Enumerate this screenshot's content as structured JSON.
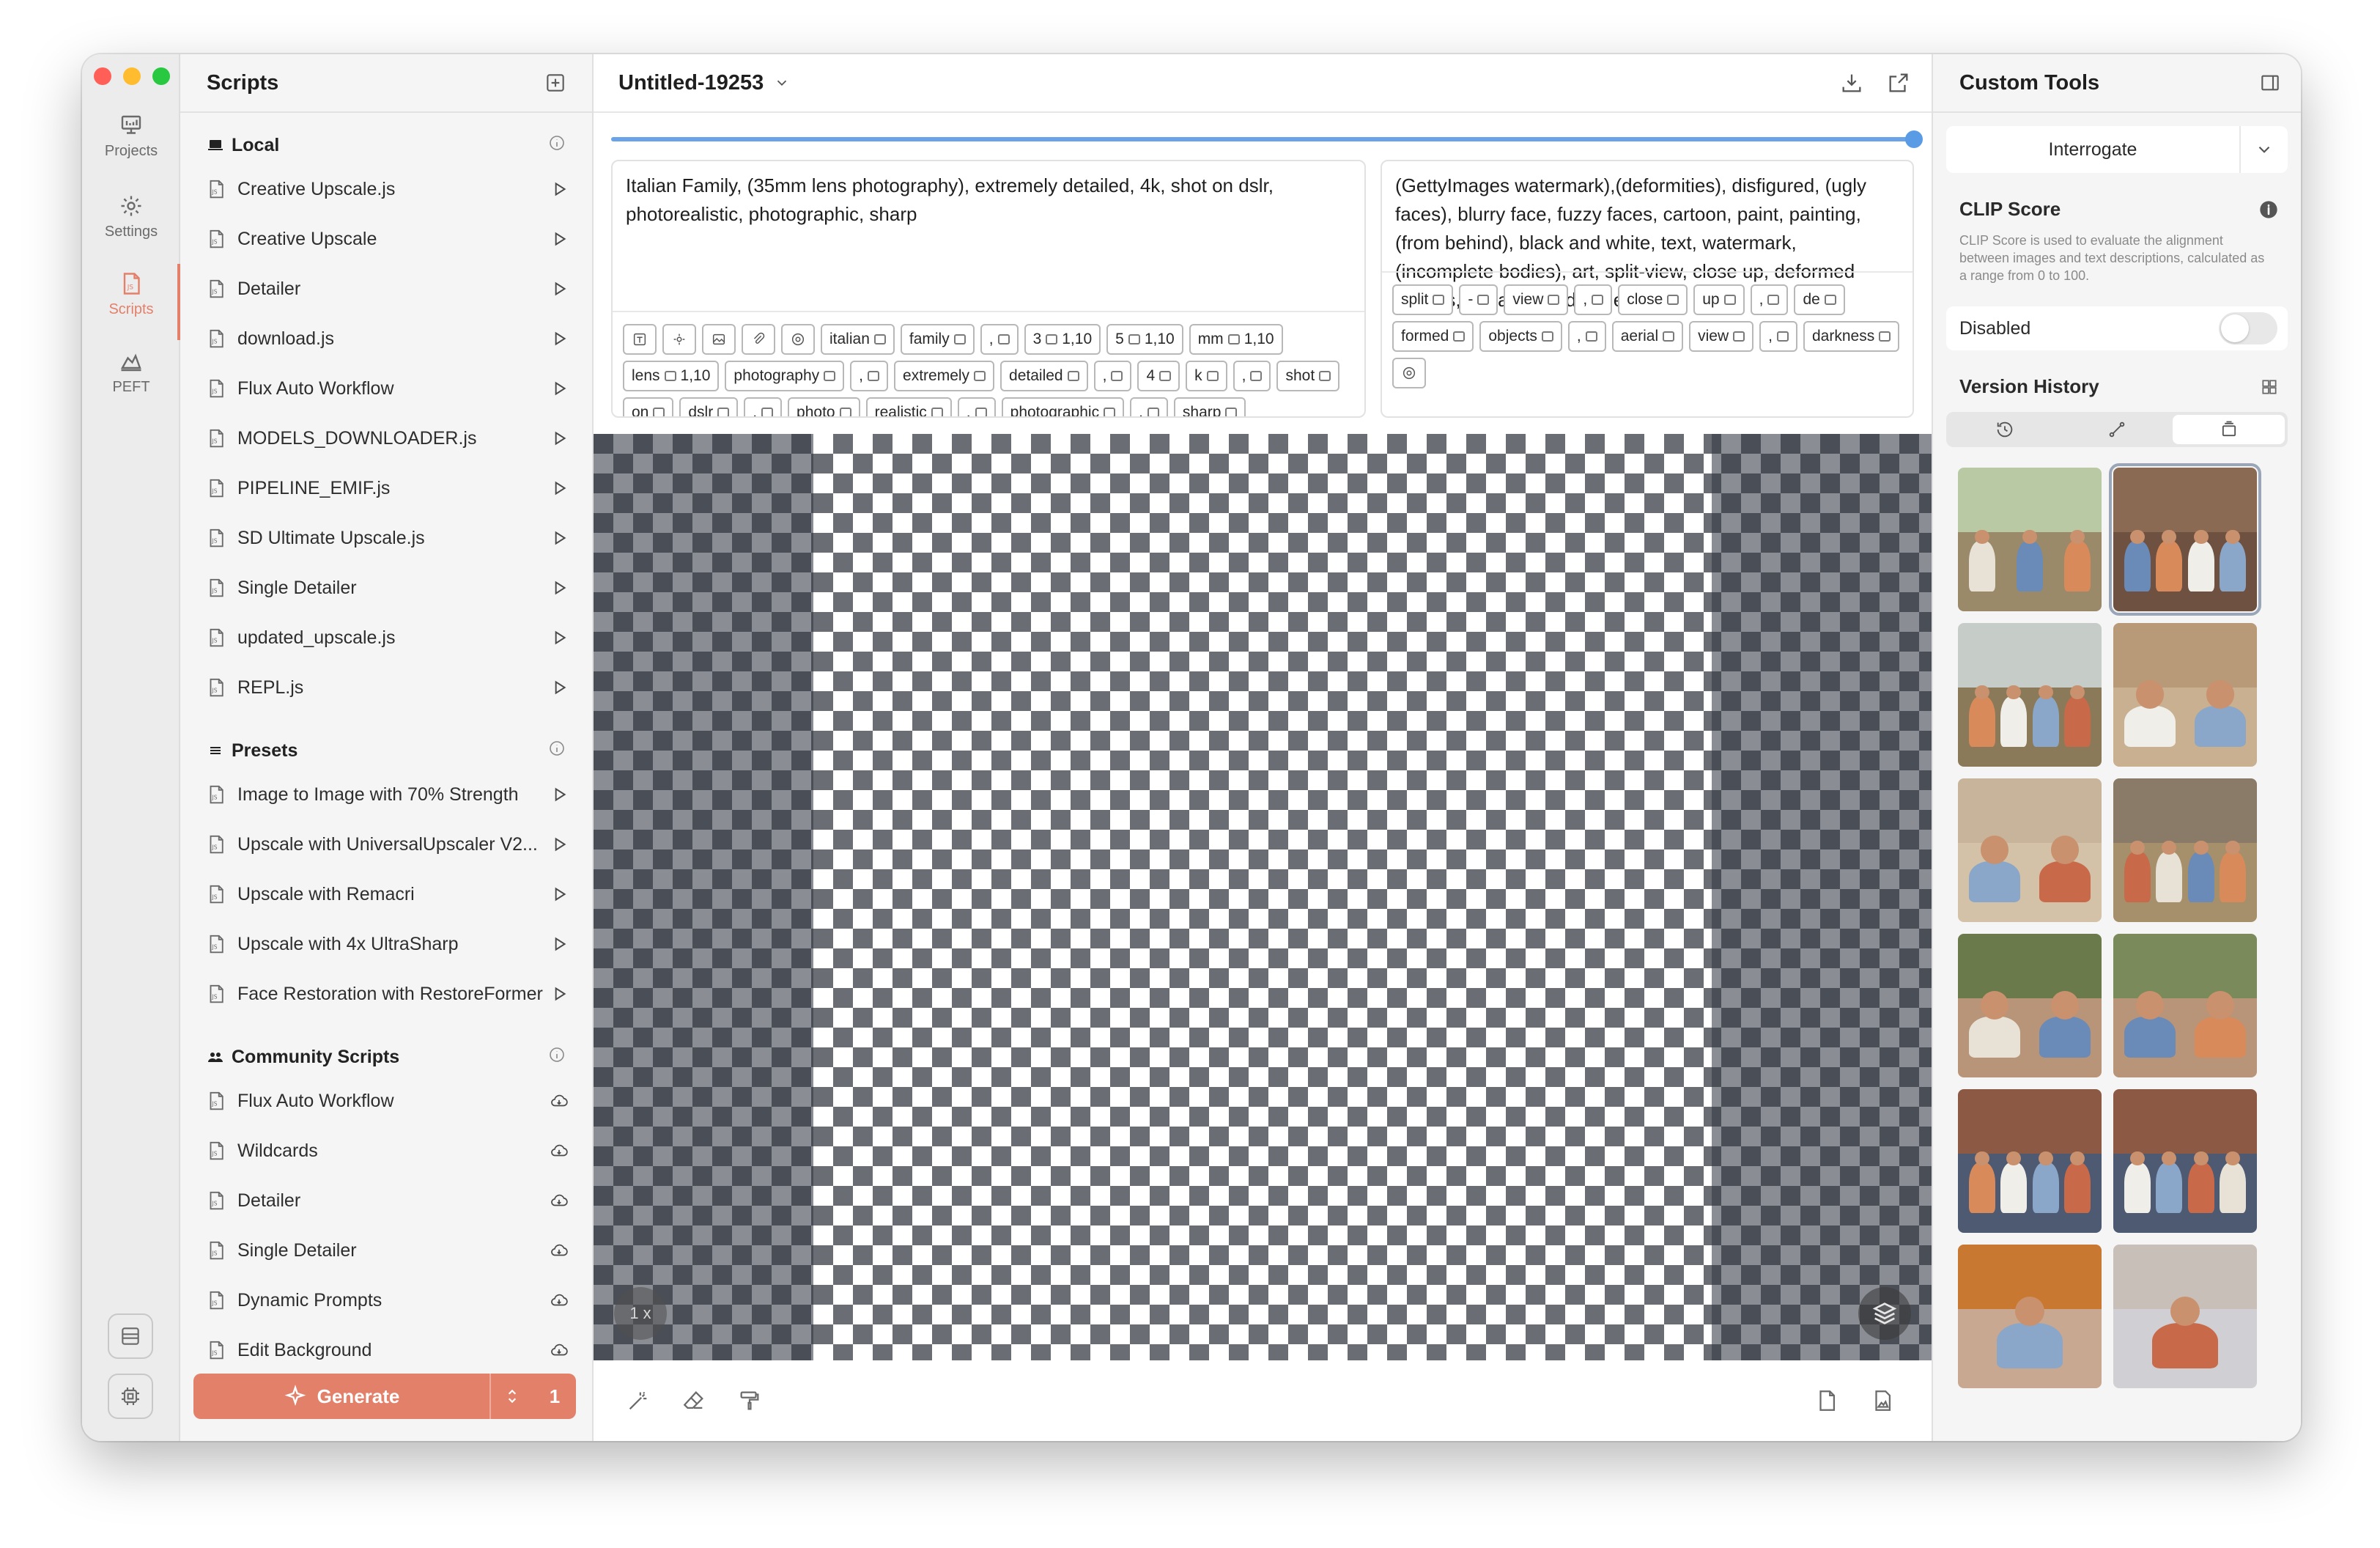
{
  "window": {
    "traffic_colors": [
      "#ff5f57",
      "#febc2e",
      "#28c840"
    ]
  },
  "rail": {
    "items": [
      {
        "label": "Projects",
        "icon": "projects-icon"
      },
      {
        "label": "Settings",
        "icon": "settings-gear-icon"
      },
      {
        "label": "Scripts",
        "icon": "scripts-js-icon",
        "active": true
      },
      {
        "label": "PEFT",
        "icon": "peft-icon"
      }
    ],
    "accent": "#e3806a"
  },
  "scripts_panel": {
    "title": "Scripts",
    "sections": [
      {
        "title": "Local",
        "items": [
          "Creative Upscale.js",
          "Creative Upscale",
          "Detailer",
          "download.js",
          "Flux Auto Workflow",
          "MODELS_DOWNLOADER.js",
          "PIPELINE_EMIF.js",
          "SD Ultimate Upscale.js",
          "Single Detailer",
          "updated_upscale.js",
          "REPL.js"
        ]
      },
      {
        "title": "Presets",
        "items": [
          "Image to Image with 70% Strength",
          "Upscale with UniversalUpscaler V2...",
          "Upscale with Remacri",
          "Upscale with 4x UltraSharp",
          "Face Restoration with RestoreFormer"
        ]
      },
      {
        "title": "Community Scripts",
        "items": [
          "Flux Auto Workflow",
          "Wildcards",
          "Detailer",
          "Single Detailer",
          "Dynamic Prompts",
          "Edit Background"
        ]
      }
    ],
    "generate": {
      "label": "Generate",
      "count": "1"
    }
  },
  "center": {
    "title": "Untitled-19253",
    "slider_value": 1.0,
    "positive_prompt": "Italian Family, (35mm lens photography), extremely detailed, 4k, shot on dslr, photorealistic, photographic, sharp",
    "negative_prompt": "(GettyImages watermark),(deformities), disfigured, (ugly faces), blurry face, fuzzy faces, cartoon, paint, painting, (from behind), black and white, text, watermark, (incomplete bodies), art, split-view, close up, deformed objects, aerial view, darkness",
    "positive_chips": [
      "italian",
      "family",
      ",",
      "3",
      "5",
      "mm",
      "lens",
      "photography",
      ",",
      "extremely",
      "detailed",
      ",",
      "4",
      "k",
      ",",
      "shot",
      "on",
      "dslr",
      ",",
      "photo",
      "realistic",
      ",",
      "photographic",
      ",",
      "sharp"
    ],
    "positive_chip_weights": {
      "3": "1,10",
      "5": "1,10",
      "mm": "1,10",
      "lens": "1,10",
      "photography": "1,10"
    },
    "negative_chips": [
      "split",
      "-",
      "view",
      ",",
      "close",
      "up",
      ",",
      "de",
      "formed",
      "objects",
      ",",
      "aerial",
      "view",
      ",",
      "darkness"
    ],
    "zoom": "1 x"
  },
  "right_panel": {
    "title": "Custom Tools",
    "interrogate_label": "Interrogate",
    "clip_score_title": "CLIP Score",
    "clip_score_desc": "CLIP Score is used to evaluate the alignment between images and text descriptions, calculated as a range from 0 to 100.",
    "disabled_label": "Disabled",
    "version_history_title": "Version History",
    "thumbnails": [
      {
        "sky": "#b9c9a4",
        "ground": "#9b8a6a",
        "people": 3,
        "selected": false
      },
      {
        "sky": "#8a6a52",
        "ground": "#6e5140",
        "people": 4,
        "selected": true
      },
      {
        "sky": "#c6cdc8",
        "ground": "#8a7a5a",
        "people": 4,
        "selected": false
      },
      {
        "sky": "#b89a78",
        "ground": "#c8b090",
        "people": 2,
        "selected": false
      },
      {
        "sky": "#c8b49a",
        "ground": "#d4c2a8",
        "people": 2,
        "selected": false
      },
      {
        "sky": "#8a7a68",
        "ground": "#a6906c",
        "people": 4,
        "selected": false
      },
      {
        "sky": "#6a7a4a",
        "ground": "#b89478",
        "people": 2,
        "selected": false
      },
      {
        "sky": "#7a8a5a",
        "ground": "#b89478",
        "people": 2,
        "selected": false
      },
      {
        "sky": "#8c5a44",
        "ground": "#4e5a72",
        "people": 4,
        "selected": false
      },
      {
        "sky": "#8c5a44",
        "ground": "#4e5a72",
        "people": 4,
        "selected": false
      },
      {
        "sky": "#c87830",
        "ground": "#c8a890",
        "people": 1,
        "selected": false
      },
      {
        "sky": "#c8c0b8",
        "ground": "#d0d0d4",
        "people": 1,
        "selected": false
      }
    ]
  }
}
